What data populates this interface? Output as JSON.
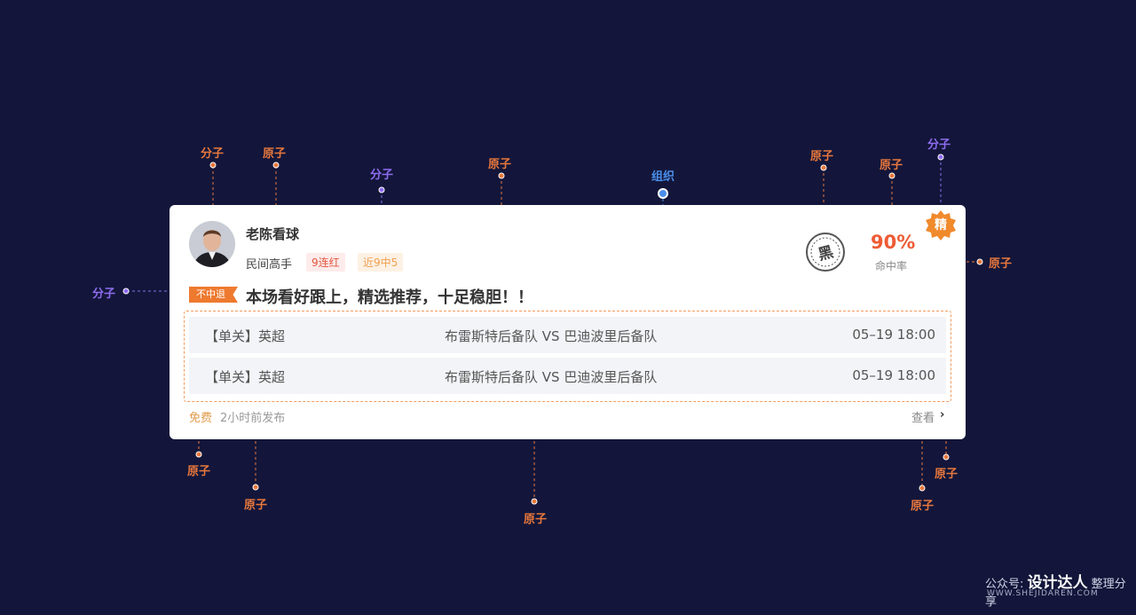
{
  "card": {
    "user_name": "老陈看球",
    "user_level": "民间高手",
    "streak_tag": "9连红",
    "recent_tag": "近9中5",
    "hit_rate": "90%",
    "hit_rate_label": "命中率",
    "featured_badge": "精",
    "stamp_text": "黑",
    "miss_tag": "不中退",
    "headline": "本场看好跟上，精选推荐，十足稳胆！！",
    "matches": [
      {
        "league": "【单关】英超",
        "teams": "布雷斯特后备队 VS 巴迪波里后备队",
        "time": "05–19   18:00"
      },
      {
        "league": "【单关】英超",
        "teams": "布雷斯特后备队 VS 巴迪波里后备队",
        "time": "05–19   18:00"
      }
    ],
    "price": "免费",
    "posted": "2小时前发布",
    "view": "查看",
    "chevron": "›"
  },
  "annotations": {
    "molecule": "分子",
    "atom": "原子",
    "organism": "组织"
  },
  "watermark": {
    "prefix": "公众号:",
    "brand": "设计达人",
    "suffix": "整理分享",
    "url": "WWW.SHEJIDAREN.COM"
  },
  "colors": {
    "background": "#13163a",
    "atom": "#e7773d",
    "molecule": "#8e6cf0",
    "organism": "#4a8ee9",
    "accent": "#ee5b35"
  }
}
